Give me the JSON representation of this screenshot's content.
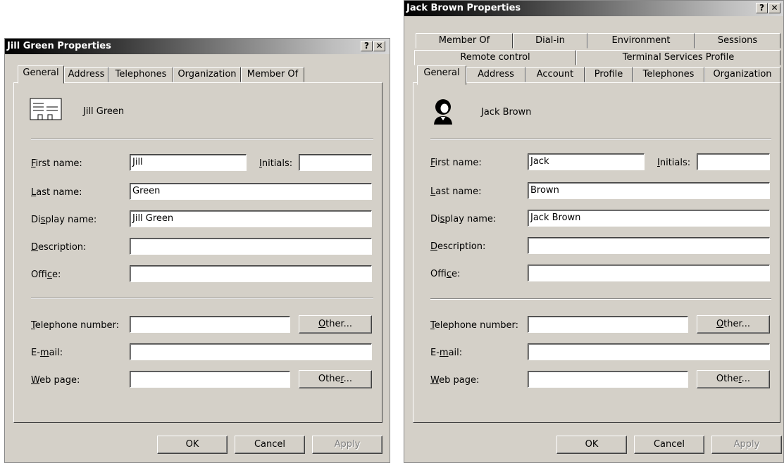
{
  "title_bar": {
    "help_label": "?",
    "close_label": "✕"
  },
  "dialogs": [
    {
      "title": "Jill Green Properties",
      "tabs": [
        "General",
        "Address",
        "Telephones",
        "Organization",
        "Member Of"
      ],
      "selected_tab": "General",
      "header_name": "Jill Green",
      "fields": {
        "first_name": {
          "label_hot": "F",
          "label_rest": "irst name:",
          "value": "Jill"
        },
        "initials": {
          "label_hot": "I",
          "label_rest": "nitials:",
          "value": ""
        },
        "last_name": {
          "label_hot": "L",
          "label_rest": "ast name:",
          "value": "Green"
        },
        "display_name": {
          "label_pre": "Di",
          "label_hot": "s",
          "label_rest": "play name:",
          "value": "Jill Green"
        },
        "description": {
          "label_hot": "D",
          "label_rest": "escription:",
          "value": ""
        },
        "office": {
          "label_pre": "Offi",
          "label_hot": "c",
          "label_rest": "e:",
          "value": ""
        },
        "telephone": {
          "label_hot": "T",
          "label_rest": "elephone number:",
          "value": ""
        },
        "email": {
          "label_pre": "E-",
          "label_hot": "m",
          "label_rest": "ail:",
          "value": ""
        },
        "webpage": {
          "label_hot": "W",
          "label_rest": "eb page:",
          "value": ""
        }
      },
      "other_tel": {
        "hot": "O",
        "rest": "ther..."
      },
      "other_web": {
        "pre": "Othe",
        "hot": "r",
        "rest": "..."
      },
      "buttons": {
        "ok": "OK",
        "cancel": "Cancel",
        "apply": "Apply"
      }
    },
    {
      "title": "Jack Brown Properties",
      "tab_rows": [
        [
          "Member Of",
          "Dial-in",
          "Environment",
          "Sessions"
        ],
        [
          "Remote control",
          "Terminal Services Profile"
        ],
        [
          "General",
          "Address",
          "Account",
          "Profile",
          "Telephones",
          "Organization"
        ]
      ],
      "selected_tab": "General",
      "header_name": "Jack Brown",
      "fields": {
        "first_name": {
          "label_hot": "F",
          "label_rest": "irst name:",
          "value": "Jack"
        },
        "initials": {
          "label_hot": "I",
          "label_rest": "nitials:",
          "value": ""
        },
        "last_name": {
          "label_hot": "L",
          "label_rest": "ast name:",
          "value": "Brown"
        },
        "display_name": {
          "label_pre": "Di",
          "label_hot": "s",
          "label_rest": "play name:",
          "value": "Jack Brown"
        },
        "description": {
          "label_hot": "D",
          "label_rest": "escription:",
          "value": ""
        },
        "office": {
          "label_pre": "Offi",
          "label_hot": "c",
          "label_rest": "e:",
          "value": ""
        },
        "telephone": {
          "label_hot": "T",
          "label_rest": "elephone number:",
          "value": ""
        },
        "email": {
          "label_pre": "E-",
          "label_hot": "m",
          "label_rest": "ail:",
          "value": ""
        },
        "webpage": {
          "label_hot": "W",
          "label_rest": "eb page:",
          "value": ""
        }
      },
      "other_tel": {
        "hot": "O",
        "rest": "ther..."
      },
      "other_web": {
        "pre": "Othe",
        "hot": "r",
        "rest": "..."
      },
      "buttons": {
        "ok": "OK",
        "cancel": "Cancel",
        "apply": "Apply"
      }
    }
  ]
}
